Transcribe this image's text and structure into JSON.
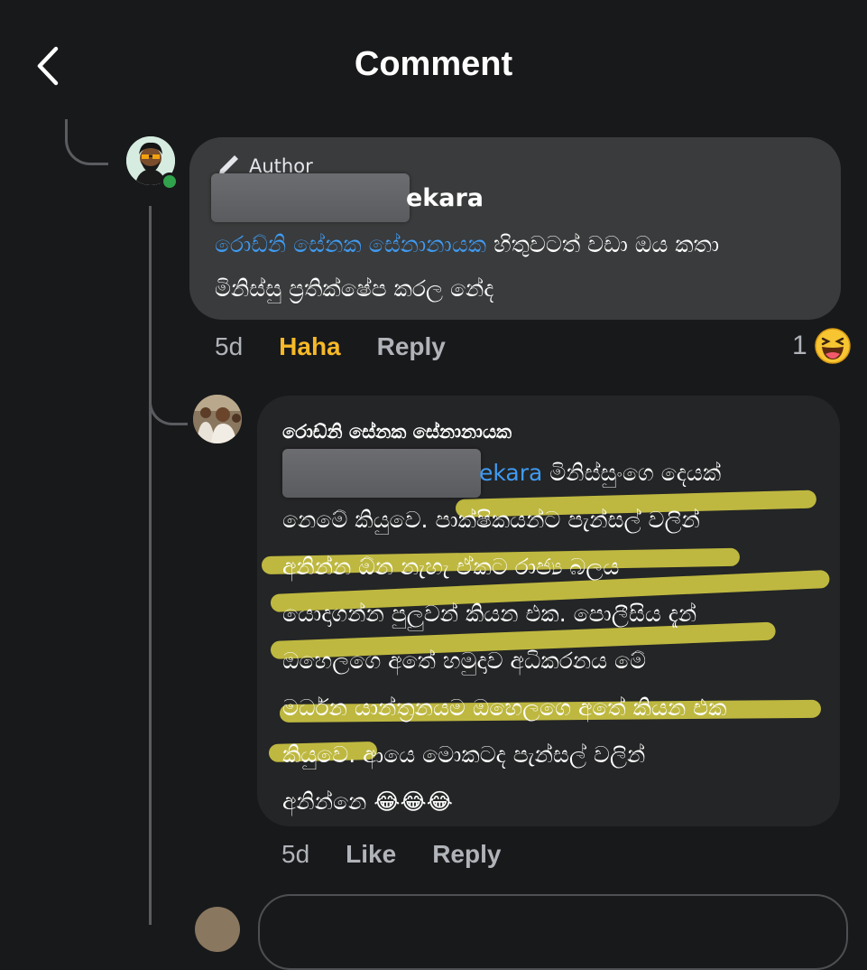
{
  "header": {
    "title": "Comment",
    "back_icon": "chevron-left-icon"
  },
  "comment1": {
    "author_tag": "Author",
    "name_visible": "ekara",
    "mention": "රොඩ්නි සේනක සේනානායක",
    "text_line1": " හිතුවටත් වඩා ඔය කතා",
    "text_line2": "මිනිස්සු ප්‍රතික්ෂේප කරල නේද",
    "time": "5d",
    "reaction_button": "Haha",
    "reply_button": "Reply",
    "reaction_count": "1",
    "reaction_emoji": "😆"
  },
  "comment2": {
    "name": "රොඩ්නි සේනක සේනානායක",
    "mention_visible": "ekara",
    "line1": " මිනිස්සුංගෙ දෙයක්",
    "line2": "නෙමේ කියුවෙ. පාක්ෂිකයන්ට පැන්සල් වලින්",
    "line3": "අනින්න ඕන නැහැ ඒකට රාජ්‍ය බලය",
    "line4": "යොදාගන්න පුලුවන් කියන එක. පොලීසිය දැන්",
    "line5": "ඔහෙලගෙ අතේ හමුදාව අධිකරනය මේ",
    "line6": "මර්ධන යාන්ත්‍රනයම ඔහෙලගෙ අතේ කියන එක",
    "line7": "කියුවෙ. ආයෙ මොකටද පැන්සල් වලින්",
    "line8": "අනින්නෙ",
    "emojis": [
      "😂",
      "😂",
      "😂"
    ],
    "time": "5d",
    "like_button": "Like",
    "reply_button": "Reply"
  },
  "colors": {
    "background": "#18191b",
    "bubble": "#3a3b3c",
    "mention": "#3f9bf2",
    "haha_active": "#f7b928",
    "highlight": "#e6dc28",
    "online": "#31a24c"
  }
}
